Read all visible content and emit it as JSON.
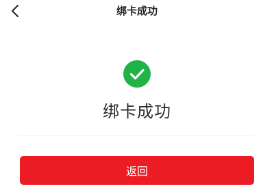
{
  "header": {
    "title": "绑卡成功",
    "back_icon": "chevron-left-icon"
  },
  "result": {
    "icon": "check-circle-icon",
    "icon_color": "#21b345",
    "title": "绑卡成功"
  },
  "actions": {
    "return_label": "返回",
    "return_color": "#eb1c24"
  }
}
